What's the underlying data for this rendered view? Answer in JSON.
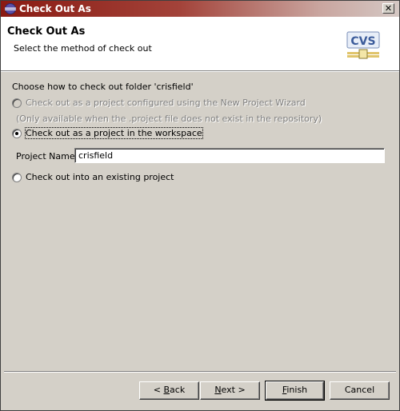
{
  "window": {
    "title": "Check Out As",
    "close_glyph": "✕"
  },
  "header": {
    "title": "Check Out As",
    "description": "Select the method of check out",
    "logo_text": "CVS"
  },
  "body": {
    "group_label": "Choose how to check out folder 'crisfield'",
    "options": [
      {
        "label": "Check out as a project configured using the New Project Wizard",
        "enabled": false,
        "selected": false
      },
      {
        "label": "Check out as a project in the workspace",
        "enabled": true,
        "selected": true
      },
      {
        "label": "Check out into an existing project",
        "enabled": true,
        "selected": false
      }
    ],
    "note": "(Only available when the .project file does not exist in the repository)",
    "project_name_label": "Project Name:",
    "project_name_value": "crisfield"
  },
  "buttons": {
    "back": {
      "mnemonic": "B",
      "rest": "ack",
      "prefix": "< "
    },
    "next": {
      "mnemonic": "N",
      "rest": "ext >"
    },
    "finish": {
      "mnemonic": "F",
      "rest": "inish"
    },
    "cancel": "Cancel"
  },
  "colors": {
    "titlebar_start": "#8a1a12",
    "dialog_bg": "#d4d0c8",
    "header_bg": "#ffffff"
  }
}
